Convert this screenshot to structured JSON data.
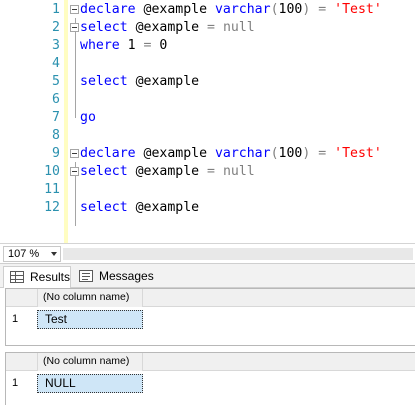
{
  "editor": {
    "lines": [
      {
        "num": "1",
        "segments": [
          {
            "t": "declare",
            "c": "kw"
          },
          {
            "t": " @example ",
            "c": ""
          },
          {
            "t": "varchar",
            "c": "kw"
          },
          {
            "t": "(",
            "c": "op"
          },
          {
            "t": "100",
            "c": ""
          },
          {
            "t": ")",
            "c": "op"
          },
          {
            "t": " ",
            "c": ""
          },
          {
            "t": "=",
            "c": "op"
          },
          {
            "t": " ",
            "c": ""
          },
          {
            "t": "'Test'",
            "c": "str"
          }
        ]
      },
      {
        "num": "2",
        "segments": [
          {
            "t": "select",
            "c": "kw"
          },
          {
            "t": " @example ",
            "c": ""
          },
          {
            "t": "=",
            "c": "op"
          },
          {
            "t": " ",
            "c": ""
          },
          {
            "t": "null",
            "c": "op"
          }
        ]
      },
      {
        "num": "3",
        "segments": [
          {
            "t": "where",
            "c": "kw"
          },
          {
            "t": " 1 ",
            "c": ""
          },
          {
            "t": "=",
            "c": "op"
          },
          {
            "t": " 0",
            "c": ""
          }
        ]
      },
      {
        "num": "4",
        "segments": []
      },
      {
        "num": "5",
        "segments": [
          {
            "t": "select",
            "c": "kw"
          },
          {
            "t": " @example",
            "c": ""
          }
        ]
      },
      {
        "num": "6",
        "segments": []
      },
      {
        "num": "7",
        "segments": [
          {
            "t": "go",
            "c": "kw"
          }
        ]
      },
      {
        "num": "8",
        "segments": []
      },
      {
        "num": "9",
        "segments": [
          {
            "t": "declare",
            "c": "kw"
          },
          {
            "t": " @example ",
            "c": ""
          },
          {
            "t": "varchar",
            "c": "kw"
          },
          {
            "t": "(",
            "c": "op"
          },
          {
            "t": "100",
            "c": ""
          },
          {
            "t": ")",
            "c": "op"
          },
          {
            "t": " ",
            "c": ""
          },
          {
            "t": "=",
            "c": "op"
          },
          {
            "t": " ",
            "c": ""
          },
          {
            "t": "'Test'",
            "c": "str"
          }
        ]
      },
      {
        "num": "10",
        "segments": [
          {
            "t": "select",
            "c": "kw"
          },
          {
            "t": " @example ",
            "c": ""
          },
          {
            "t": "=",
            "c": "op"
          },
          {
            "t": " ",
            "c": ""
          },
          {
            "t": "null",
            "c": "op"
          }
        ]
      },
      {
        "num": "11",
        "segments": []
      },
      {
        "num": "12",
        "segments": [
          {
            "t": "select",
            "c": "kw"
          },
          {
            "t": " @example",
            "c": ""
          }
        ]
      }
    ]
  },
  "zoom": {
    "value": "107 %"
  },
  "tabs": {
    "results": "Results",
    "messages": "Messages"
  },
  "grid1": {
    "header": "(No column name)",
    "row_num": "1",
    "value": "Test"
  },
  "grid2": {
    "header": "(No column name)",
    "row_num": "1",
    "value": "NULL"
  }
}
